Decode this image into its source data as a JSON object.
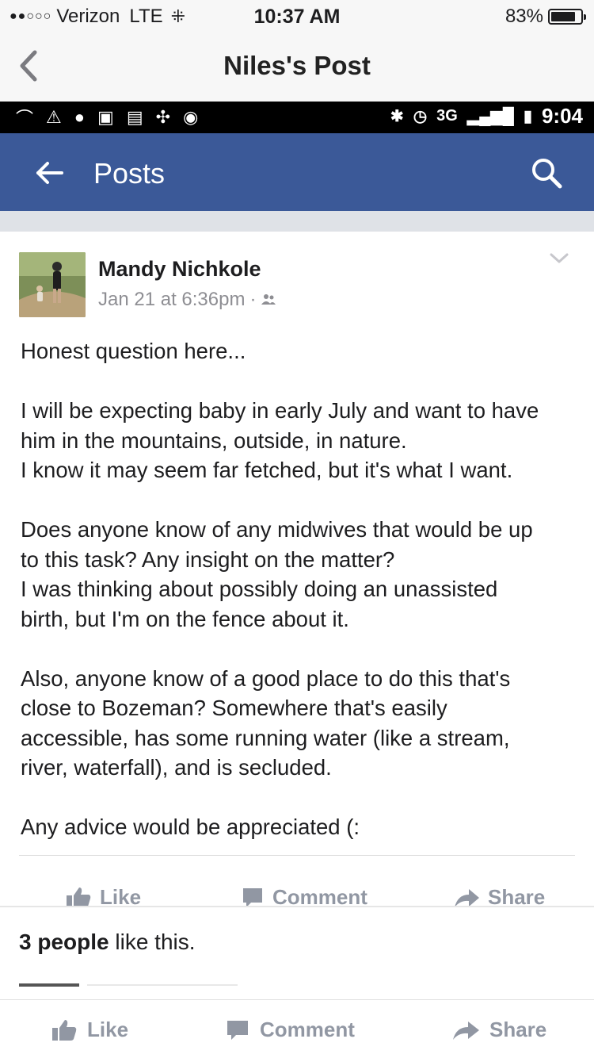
{
  "ios_status": {
    "carrier": "Verizon",
    "network": "LTE",
    "time": "10:37 AM",
    "battery_percent": "83%",
    "battery_level": 0.83
  },
  "ios_nav": {
    "title": "Niles's Post"
  },
  "android_status": {
    "network": "3G",
    "time": "9:04"
  },
  "fb_header": {
    "title": "Posts"
  },
  "post": {
    "author": "Mandy Nichkole",
    "timestamp": "Jan 21 at 6:36pm",
    "separator": "·",
    "paragraphs": [
      [
        "Honest question here..."
      ],
      [
        "I will be expecting baby in early July and want to have",
        "him in the mountains, outside, in nature.",
        "I know it may seem far fetched, but it's what I want."
      ],
      [
        "Does anyone know of any midwives that would be up",
        "to this task? Any insight on the matter?",
        "I was thinking about possibly doing an unassisted",
        "birth, but I'm on the fence about it."
      ],
      [
        "Also, anyone know of a good place to do this that's",
        "close to Bozeman? Somewhere that's easily",
        "accessible, has some running water (like a stream,",
        "river, waterfall), and is secluded."
      ],
      [
        "Any advice would be appreciated (:"
      ]
    ],
    "actions": {
      "like": "Like",
      "comment": "Comment",
      "share": "Share"
    }
  },
  "likes": {
    "count_text": "3 people",
    "suffix": "like this."
  },
  "bottom_actions": {
    "like": "Like",
    "comment": "Comment",
    "share": "Share"
  },
  "colors": {
    "facebook_blue": "#3b5998",
    "action_gray": "#9197a3",
    "meta_gray": "#8e8e93"
  }
}
